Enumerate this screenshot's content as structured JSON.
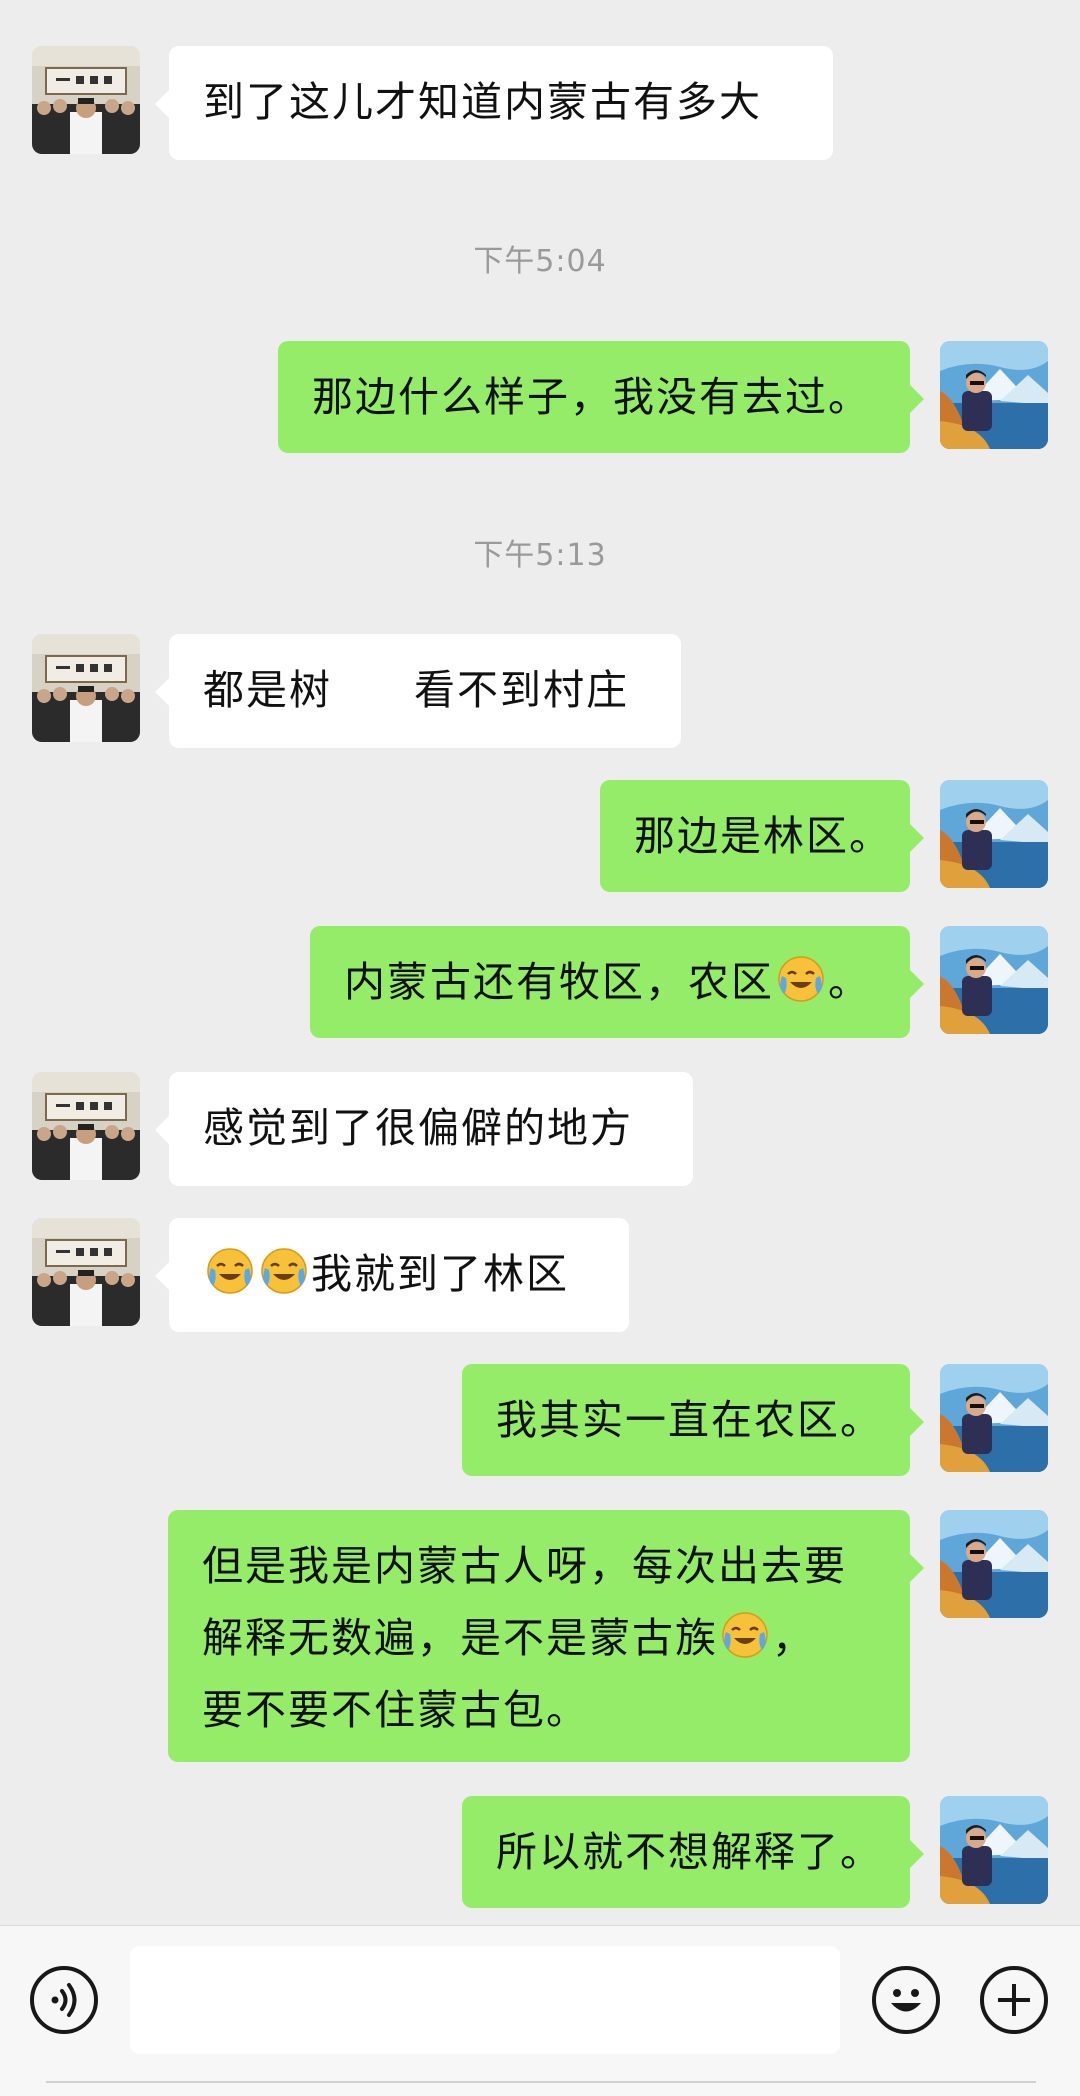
{
  "conversation": {
    "timestamps": [
      "下午5:04",
      "下午5:13"
    ],
    "messages": [
      {
        "side": "in",
        "text": "到了这儿才知道内蒙古有多大"
      },
      {
        "side": "out",
        "text": "那边什么样子，我没有去过。"
      },
      {
        "side": "in",
        "text_a": "都是树",
        "text_b": "看不到村庄"
      },
      {
        "side": "out",
        "text": "那边是林区。"
      },
      {
        "side": "out",
        "text_a": "内蒙古还有牧区，农区",
        "emoji": "face-with-tears-of-joy",
        "text_b": "。"
      },
      {
        "side": "in",
        "text": "感觉到了很偏僻的地方"
      },
      {
        "side": "in",
        "emoji": "face-with-tears-of-joy",
        "text": "我就到了林区"
      },
      {
        "side": "out",
        "text": "我其实一直在农区。"
      },
      {
        "side": "out",
        "line1": "但是我是内蒙古人呀，每次出去要",
        "line2_a": "解释无数遍，是不是蒙古族",
        "line2_emoji": "face-with-tears-of-joy",
        "line2_b": "，",
        "line3": "要不要不住蒙古包。"
      },
      {
        "side": "out",
        "text": "所以就不想解释了。"
      }
    ]
  },
  "input_bar": {
    "voice_icon": "voice-icon",
    "text_value": "",
    "emoji_icon": "smiley-icon",
    "more_icon": "plus-icon"
  },
  "colors": {
    "background": "#ededed",
    "outgoing_bubble": "#95ec69",
    "incoming_bubble": "#ffffff",
    "timestamp": "#9a9a9a"
  }
}
